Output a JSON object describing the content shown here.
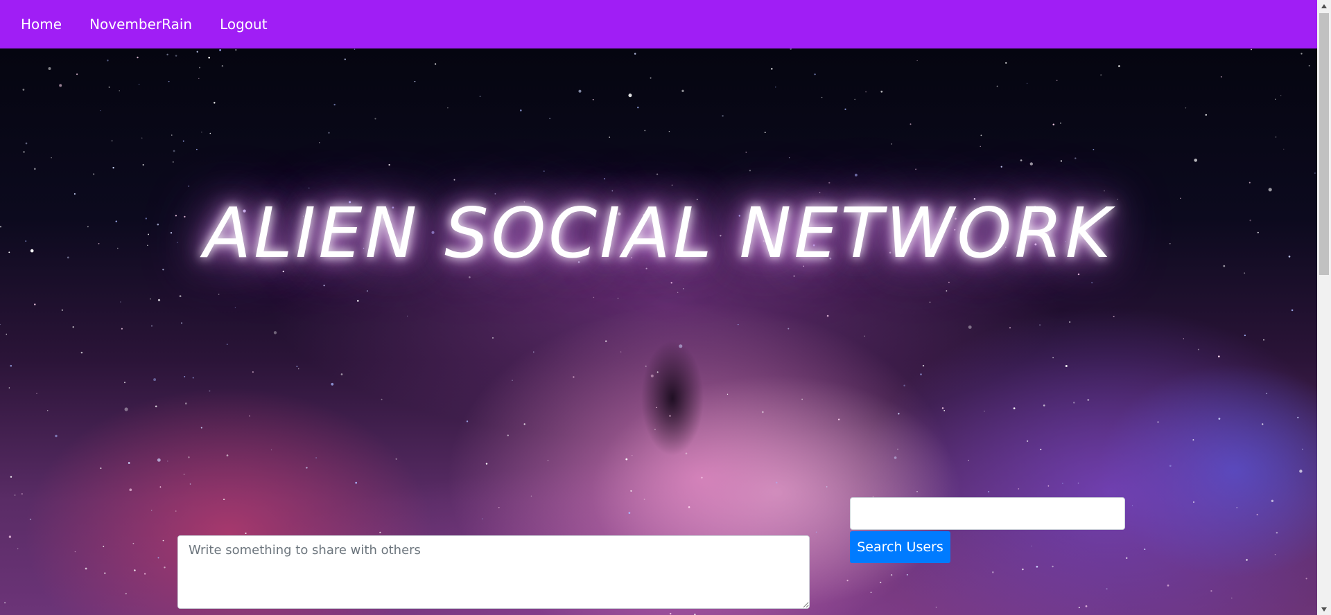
{
  "nav": {
    "items": [
      {
        "label": "Home"
      },
      {
        "label": "NovemberRain"
      },
      {
        "label": "Logout"
      }
    ],
    "background_color": "#a01ef5"
  },
  "hero": {
    "title": "ALIEN SOCIAL NETWORK"
  },
  "post": {
    "placeholder": "Write something to share with others",
    "value": ""
  },
  "search": {
    "input_value": "",
    "button_label": "Search Users",
    "button_color": "#007bff"
  },
  "scrollbar": {
    "up_icon": "scroll-up-arrow-icon",
    "down_icon": "scroll-down-arrow-icon"
  }
}
